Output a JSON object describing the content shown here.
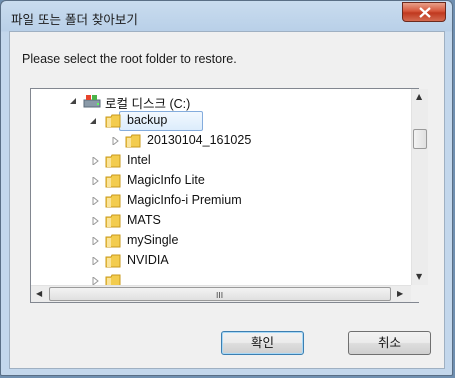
{
  "dialog": {
    "title": "파일 또는 폴더 찾아보기",
    "prompt": "Please select the root folder to restore."
  },
  "tree": {
    "drive_label": "로컬 디스크 (C:)",
    "items": [
      {
        "label": "backup",
        "selected": true,
        "expanded": true
      },
      {
        "label": "20130104_161025",
        "child_of": "backup"
      },
      {
        "label": "Intel"
      },
      {
        "label": "MagicInfo Lite"
      },
      {
        "label": "MagicInfo-i Premium"
      },
      {
        "label": "MATS"
      },
      {
        "label": "mySingle"
      },
      {
        "label": "NVIDIA"
      }
    ]
  },
  "scrollbar": {
    "h_grip": "III"
  },
  "buttons": {
    "ok_label": "확인",
    "cancel_label": "취소"
  },
  "icons": {
    "close": "close-icon",
    "drive": "drive-icon",
    "folder": "folder-icon",
    "expand": "expand-arrow-icon",
    "collapse": "collapse-arrow-icon"
  },
  "colors": {
    "selection_border": "#84acdd",
    "folder": "#e8b830",
    "close_button": "#c0391f"
  }
}
